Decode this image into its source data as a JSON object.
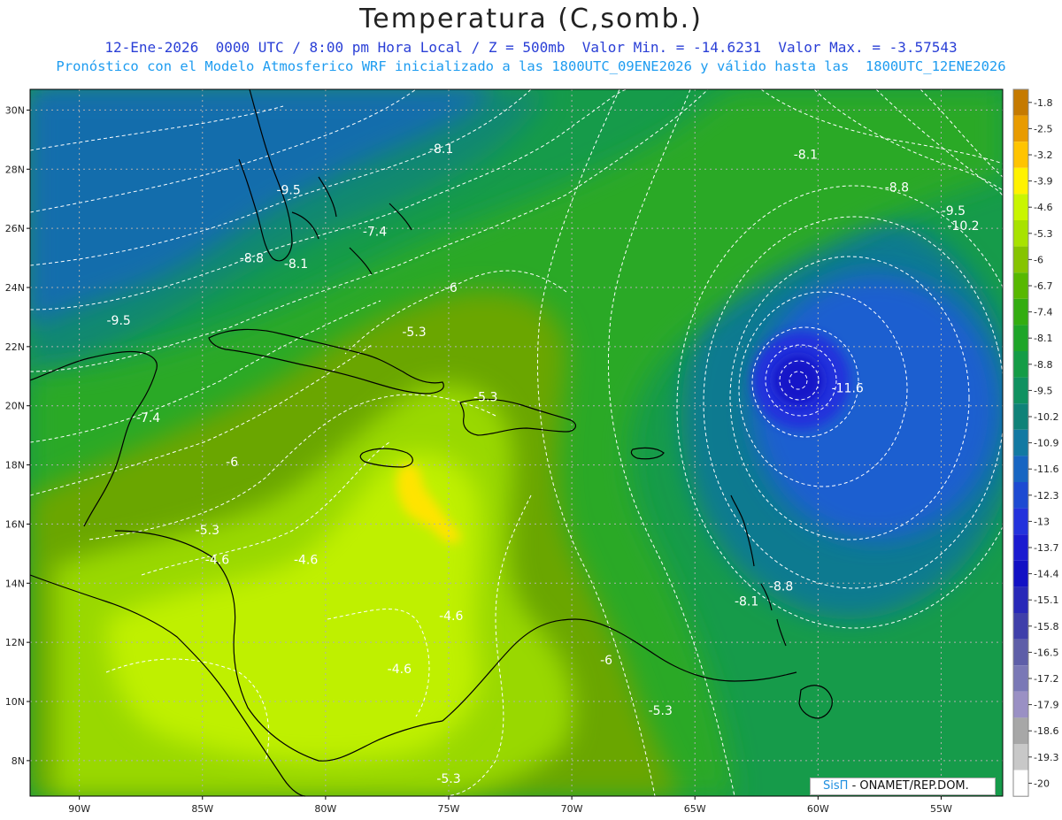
{
  "header": {
    "title": "Temperatura (C,somb.)",
    "line1": "12-Ene-2026  0000 UTC / 8:00 pm Hora Local / Z = 500mb  Valor Min. = -14.6231  Valor Max. = -3.57543",
    "line2": "Pronóstico con el Modelo Atmosferico WRF inicializado a las 1800UTC_09ENE2026 y válido hasta las  1800UTC_12ENE2026"
  },
  "axes": {
    "lat_labels": [
      "30N",
      "28N",
      "26N",
      "24N",
      "22N",
      "20N",
      "18N",
      "16N",
      "14N",
      "12N",
      "10N",
      "8N"
    ],
    "lon_labels": [
      "90W",
      "85W",
      "80W",
      "75W",
      "70W",
      "65W",
      "60W",
      "55W"
    ]
  },
  "contour_labels": [
    {
      "text": "-8.1",
      "lon": -75.3,
      "lat": 28.7
    },
    {
      "text": "-8.1",
      "lon": -60.5,
      "lat": 28.5
    },
    {
      "text": "-8.8",
      "lon": -56.8,
      "lat": 27.4
    },
    {
      "text": "-9.5",
      "lon": -54.5,
      "lat": 26.6
    },
    {
      "text": "-10.2",
      "lon": -54.1,
      "lat": 26.1
    },
    {
      "text": "-9.5",
      "lon": -81.5,
      "lat": 27.3
    },
    {
      "text": "-7.4",
      "lon": -78.0,
      "lat": 25.9
    },
    {
      "text": "-8.8",
      "lon": -83.0,
      "lat": 25.0
    },
    {
      "text": "-8.1",
      "lon": -81.2,
      "lat": 24.8
    },
    {
      "text": "-6",
      "lon": -74.9,
      "lat": 24.0
    },
    {
      "text": "-9.5",
      "lon": -88.4,
      "lat": 22.9
    },
    {
      "text": "-5.3",
      "lon": -76.4,
      "lat": 22.5
    },
    {
      "text": "-11.6",
      "lon": -58.8,
      "lat": 20.6
    },
    {
      "text": "-5.3",
      "lon": -73.5,
      "lat": 20.3
    },
    {
      "text": "-7.4",
      "lon": -87.2,
      "lat": 19.6
    },
    {
      "text": "-6",
      "lon": -83.8,
      "lat": 18.1
    },
    {
      "text": "-5.3",
      "lon": -84.8,
      "lat": 15.8
    },
    {
      "text": "-4.6",
      "lon": -84.4,
      "lat": 14.8
    },
    {
      "text": "-4.6",
      "lon": -80.8,
      "lat": 14.8
    },
    {
      "text": "-8.1",
      "lon": -62.9,
      "lat": 13.4
    },
    {
      "text": "-8.8",
      "lon": -61.5,
      "lat": 13.9
    },
    {
      "text": "-4.6",
      "lon": -74.9,
      "lat": 12.9
    },
    {
      "text": "-6",
      "lon": -68.6,
      "lat": 11.4
    },
    {
      "text": "-4.6",
      "lon": -77.0,
      "lat": 11.1
    },
    {
      "text": "-5.3",
      "lon": -66.4,
      "lat": 9.7
    },
    {
      "text": "-5.3",
      "lon": -75.0,
      "lat": 7.4
    }
  ],
  "colorbar": {
    "labels": [
      "-1.8",
      "-2.5",
      "-3.2",
      "-3.9",
      "-4.6",
      "-5.3",
      "-6",
      "-6.7",
      "-7.4",
      "-8.1",
      "-8.8",
      "-9.5",
      "-10.2",
      "-10.9",
      "-11.6",
      "-12.3",
      "-13",
      "-13.7",
      "-14.4",
      "-15.1",
      "-15.8",
      "-16.5",
      "-17.2",
      "-17.9",
      "-18.6",
      "-19.3",
      "-20"
    ],
    "colors": [
      "#c57a00",
      "#e89b00",
      "#ffc400",
      "#fff200",
      "#c9f500",
      "#a8e200",
      "#86c400",
      "#57b800",
      "#33ad10",
      "#1ea528",
      "#149c46",
      "#0f9160",
      "#0f8278",
      "#1279a2",
      "#1765c2",
      "#1d4ad2",
      "#2332dc",
      "#1a1ad0",
      "#1210c4",
      "#2828b8",
      "#3f3faa",
      "#5e5ea8",
      "#7a78b6",
      "#9a90c4",
      "#a7a7a7",
      "#c8c8c8",
      "#ffffff"
    ]
  },
  "field_colors": {
    "cold_core": "#1818c8",
    "blue": "#1f5fd0",
    "teal": "#117a90",
    "green_dark": "#169b4a",
    "green": "#2aa925",
    "olive": "#6aa600",
    "lime": "#99d800",
    "yellow_green": "#bff000",
    "yellow": "#ffe400",
    "coast": "#000000",
    "contour": "#ffffff",
    "grid": "#b0b0b0"
  },
  "credit": {
    "brand": "SisΠ",
    "text": "- ONAMET/REP.DOM."
  }
}
